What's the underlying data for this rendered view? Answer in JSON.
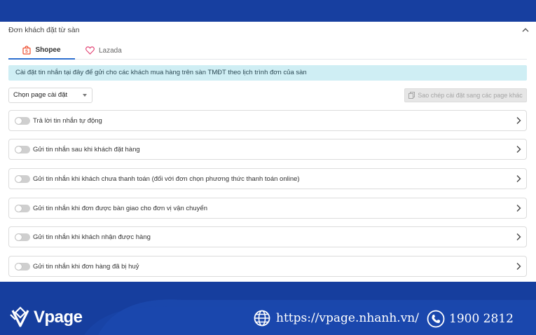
{
  "section": {
    "title": "Đơn khách đặt từ sàn"
  },
  "tabs": [
    {
      "label": "Shopee",
      "active": true,
      "icon": "shopee-bag-icon"
    },
    {
      "label": "Lazada",
      "active": false,
      "icon": "lazada-heart-icon"
    }
  ],
  "info_banner": "Cài đặt tin nhắn tại đây để gửi cho các khách mua hàng trên sàn TMĐT theo lịch trình đơn của sàn",
  "page_select": {
    "value": "Chọn page cài đặt"
  },
  "copy_button": {
    "label": "Sao chép cài đặt sang các page khác",
    "disabled": true
  },
  "settings": [
    {
      "label": "Trả lời tin nhắn tự động",
      "enabled": false
    },
    {
      "label": "Gửi tin nhắn sau khi khách đặt hàng",
      "enabled": false
    },
    {
      "label": "Gửi tin nhắn khi khách chưa thanh toán (đối với đơn chọn phương thức thanh toán online)",
      "enabled": false
    },
    {
      "label": "Gửi tin nhắn khi đơn được bàn giao cho đơn vị vận chuyển",
      "enabled": false
    },
    {
      "label": "Gửi tin nhắn khi khách nhận được hàng",
      "enabled": false
    },
    {
      "label": "Gửi tin nhắn khi đơn hàng đã bị huỷ",
      "enabled": false
    }
  ],
  "footer": {
    "brand": "Vpage",
    "website": "https://vpage.nhanh.vn/",
    "phone": "1900 2812"
  },
  "colors": {
    "brand_blue": "#163e9e",
    "tab_accent": "#2c6fcf",
    "shopee_orange": "#ee4d2d",
    "lazada_pink": "#e44d7b",
    "banner_bg": "#cfeef4"
  }
}
